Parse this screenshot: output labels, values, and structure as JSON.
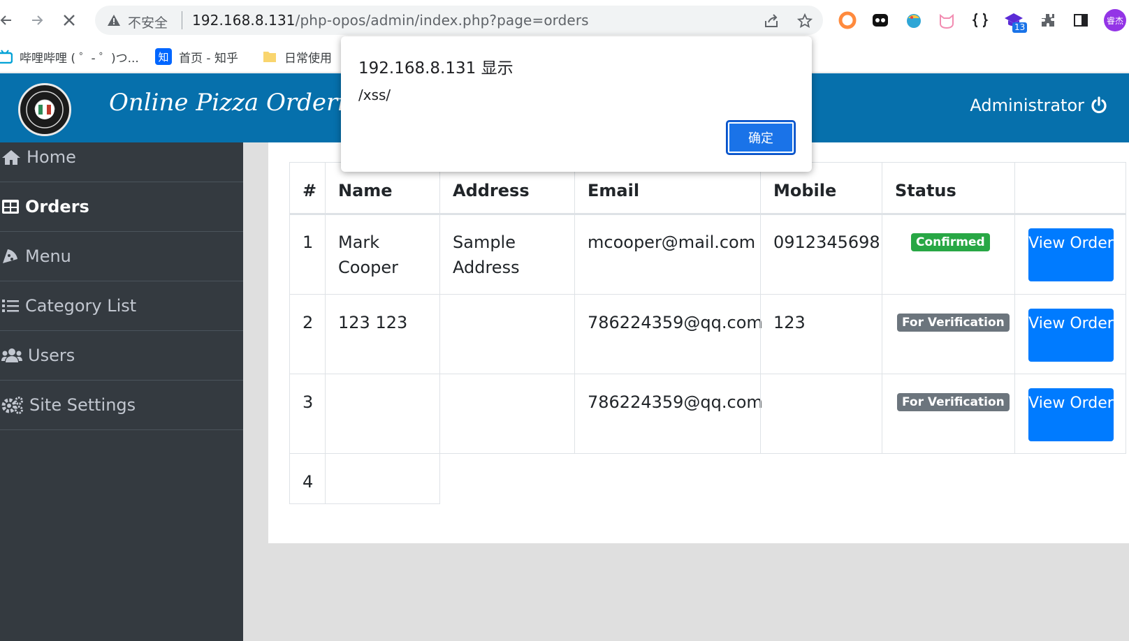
{
  "browser": {
    "insecure_label": "不安全",
    "url_host": "192.168.8.131",
    "url_rest": "/php-opos/admin/index.php?page=orders",
    "extension_badge": "13",
    "profile_label": "睿杰"
  },
  "bookmarks": [
    {
      "label": "哔哩哔哩 ( ゜- ゜)つ..."
    },
    {
      "label": "首页 - 知乎"
    },
    {
      "label": "日常使用"
    }
  ],
  "header": {
    "brand": "Online Pizza Ordering Sy",
    "user": "Administrator"
  },
  "sidebar": {
    "items": [
      {
        "label": "Home",
        "icon": "home-icon"
      },
      {
        "label": "Orders",
        "icon": "table-icon",
        "active": true
      },
      {
        "label": "Menu",
        "icon": "pizza-icon"
      },
      {
        "label": "Category List",
        "icon": "list-icon"
      },
      {
        "label": "Users",
        "icon": "users-icon"
      },
      {
        "label": "Site Settings",
        "icon": "cogs-icon"
      }
    ]
  },
  "orders": {
    "columns": [
      "#",
      "Name",
      "Address",
      "Email",
      "Mobile",
      "Status",
      ""
    ],
    "rows": [
      {
        "num": "1",
        "name": "Mark Cooper",
        "address": "Sample Address",
        "email": "mcooper@mail.com",
        "mobile": "0912345698",
        "status": "Confirmed",
        "action": "View Order"
      },
      {
        "num": "2",
        "name": "123 123",
        "address": "",
        "email": "786224359@qq.com",
        "mobile": "123",
        "status": "For Verification",
        "action": "View Order"
      },
      {
        "num": "3",
        "name": "",
        "address": "",
        "email": "786224359@qq.com",
        "mobile": "",
        "status": "For Verification",
        "action": "View Order"
      },
      {
        "num": "4",
        "name": "",
        "address": "",
        "email": "",
        "mobile": "",
        "status": "",
        "action": ""
      }
    ]
  },
  "dialog": {
    "title": "192.168.8.131 显示",
    "message": "/xss/",
    "ok_label": "确定"
  },
  "colors": {
    "header": "#0670ac",
    "sidebar": "#343a40",
    "confirmed": "#28a745",
    "verification": "#6c757d",
    "primary_button": "#007bff"
  }
}
